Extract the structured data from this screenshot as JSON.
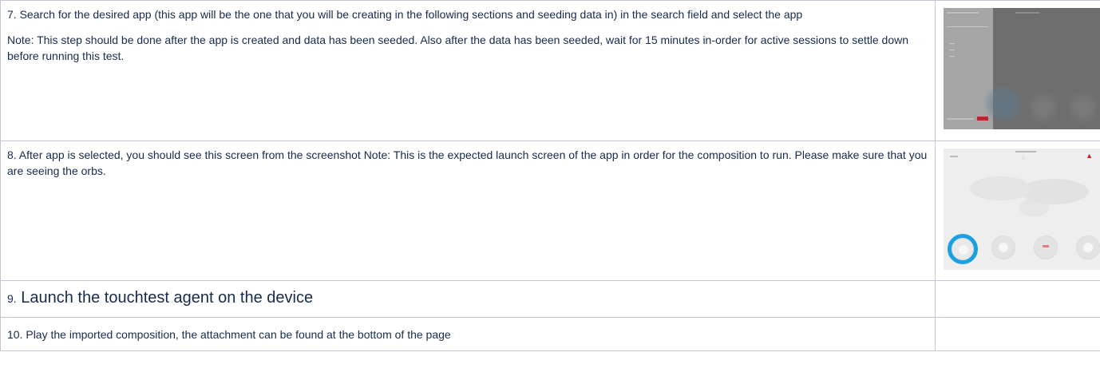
{
  "steps": [
    {
      "paragraphs": [
        "7. Search for the desired app (this app will be the one that you will be creating in the following sections and seeding data in) in the search field and select the app",
        "Note: This step should be done after the app is created and data has been seeded. Also after the data has been seeded, wait for 15 minutes in-order for active sessions to settle down before running this test."
      ]
    },
    {
      "paragraphs": [
        "8. After app is selected, you should see this screen from the screenshot Note: This is the expected launch screen of the app in order for the composition to run. Please make sure that you are seeing the orbs."
      ]
    },
    {
      "number": "9.",
      "text": " Launch the touchtest agent on the device"
    },
    {
      "paragraphs": [
        "10. Play the imported composition, the attachment can be found at the bottom of the page"
      ]
    }
  ],
  "thumbnails": {
    "step7": {
      "description_icon": "app-search-screenshot",
      "accent": "#c8202c"
    },
    "step8": {
      "description_icon": "app-launch-screenshot",
      "selected_orb_color": "#1ba1e2",
      "warning_color": "#d0202e"
    }
  }
}
